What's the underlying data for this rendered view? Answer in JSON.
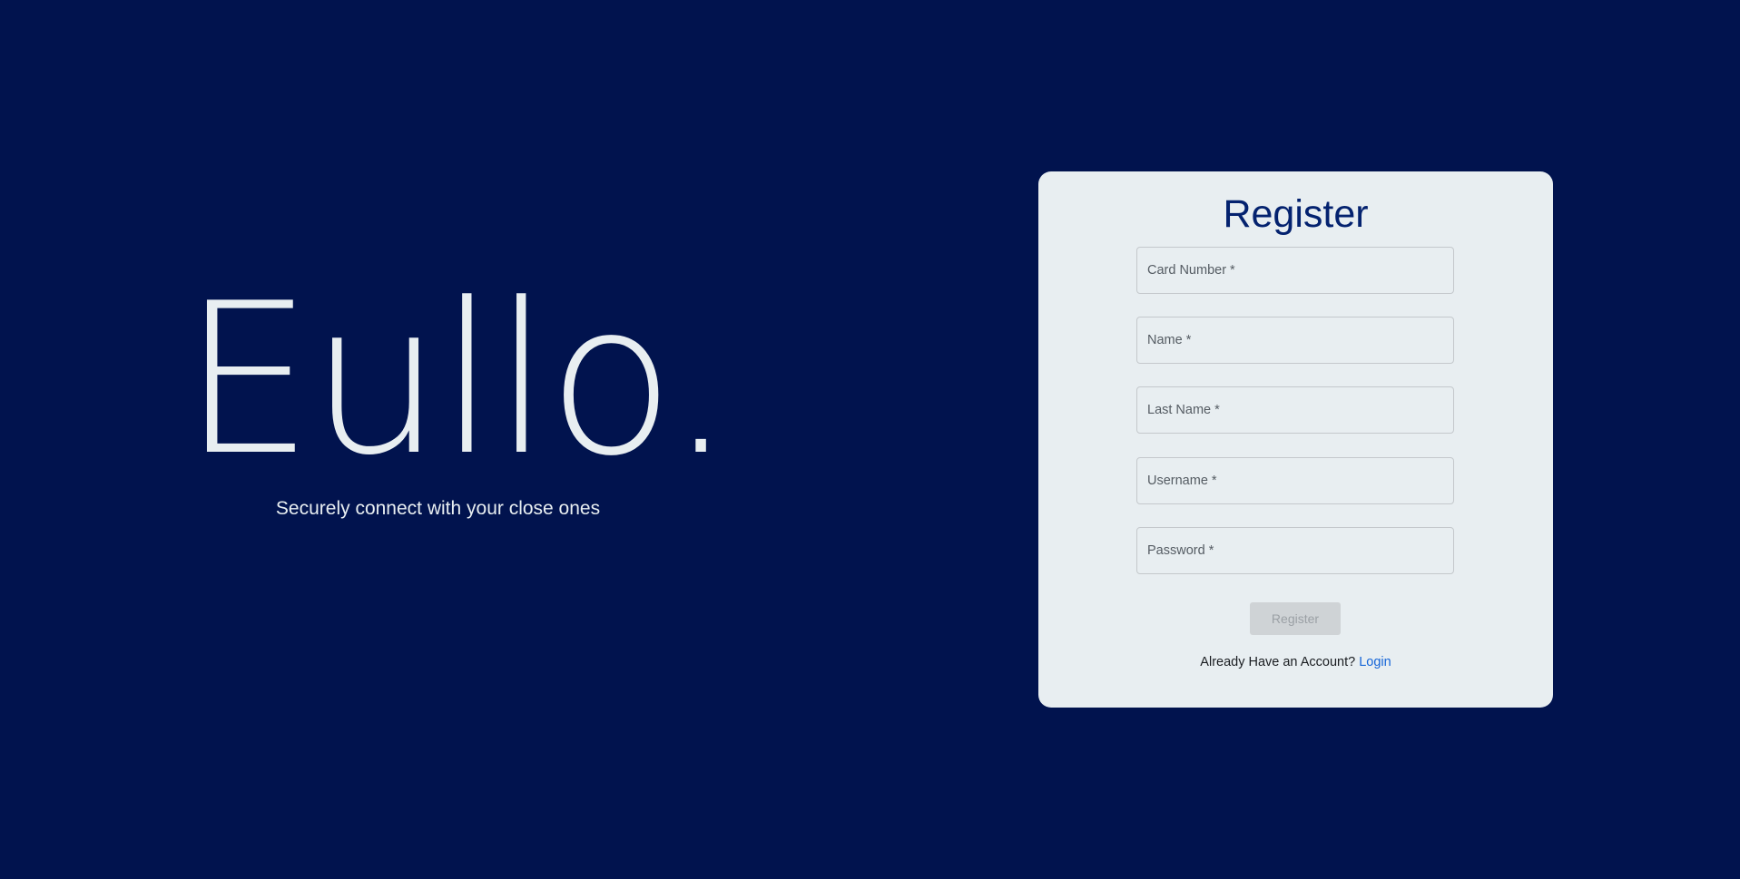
{
  "hero": {
    "brand": "Eullo.",
    "tagline": "Securely connect with your close ones"
  },
  "register": {
    "title": "Register",
    "fields": [
      {
        "placeholder": "Card Number *",
        "value": ""
      },
      {
        "placeholder": "Name *",
        "value": ""
      },
      {
        "placeholder": "Last Name *",
        "value": ""
      },
      {
        "placeholder": "Username *",
        "value": ""
      },
      {
        "placeholder": "Password *",
        "value": ""
      }
    ],
    "submit_label": "Register",
    "footer_text": "Already Have an Account?",
    "login_link": "Login"
  },
  "colors": {
    "background": "#01134e",
    "card": "#e8eef1",
    "title": "#04226f",
    "link": "#1565d8",
    "button_disabled": "#cfd3d6"
  }
}
